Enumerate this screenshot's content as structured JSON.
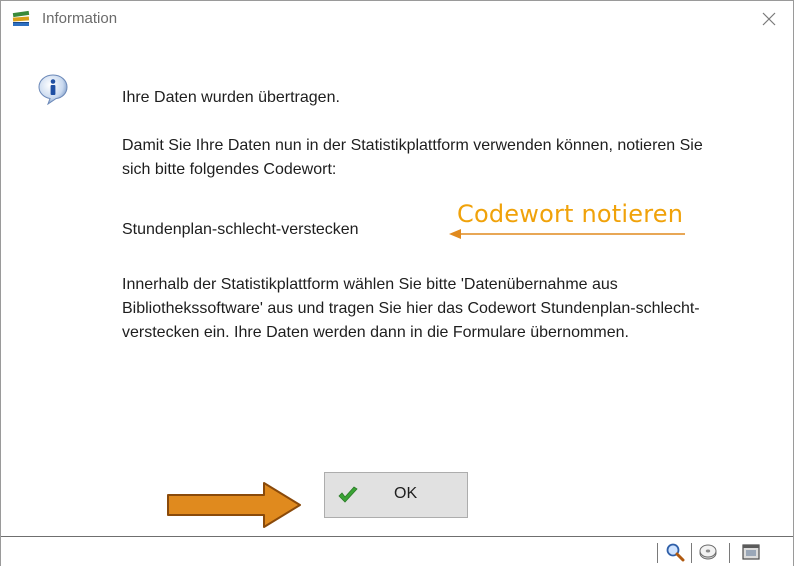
{
  "window": {
    "title": "Information",
    "app_icon": "books-icon",
    "close_icon": "close-icon"
  },
  "message": {
    "icon": "info-icon",
    "line1": "Ihre Daten wurden übertragen.",
    "paragraph2": "Damit Sie Ihre Daten nun in der Statistikplattform verwenden können, notieren Sie sich bitte folgendes Codewort:",
    "codeword": "Stundenplan-schlecht-verstecken",
    "paragraph4": "Innerhalb der Statistikplattform wählen Sie bitte 'Datenübernahme aus Bibliothekssoftware' aus und tragen Sie hier das Codewort Stundenplan-schlecht-verstecken ein. Ihre Daten werden dann in die Formulare übernommen."
  },
  "annotation": {
    "label": "Codewort notieren",
    "color": "#f0a20a"
  },
  "ok_button": {
    "label": "OK",
    "icon": "checkmark-icon"
  },
  "big_arrow_color": "#e08a1e",
  "statusbar": {
    "icons": [
      "magnifier-icon",
      "disc-icon",
      "window-icon"
    ]
  }
}
